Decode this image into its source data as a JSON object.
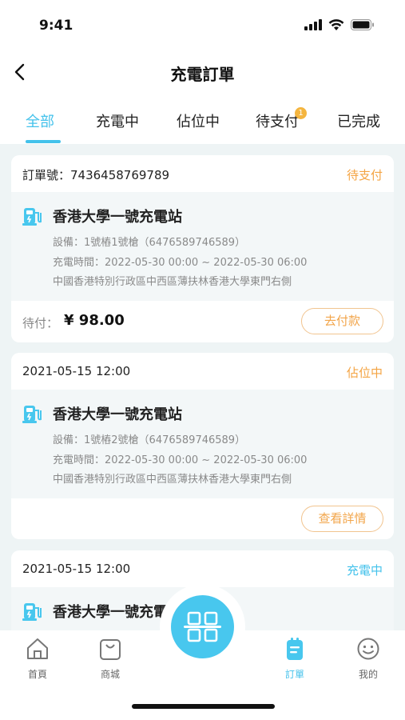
{
  "status_bar": {
    "time": "9:41"
  },
  "header": {
    "title": "充電訂單"
  },
  "tabs": [
    {
      "label": "全部"
    },
    {
      "label": "充電中"
    },
    {
      "label": "佔位中"
    },
    {
      "label": "待支付",
      "badge": "1"
    },
    {
      "label": "已完成"
    }
  ],
  "orders": [
    {
      "head_left": "訂單號：7436458769789",
      "status": "待支付",
      "station": "香港大學一號充電站",
      "device": "設備：1號樁1號槍（6476589746589）",
      "time": "充電時間：2022-05-30 00:00 ~ 2022-05-30 06:00",
      "address": "中國香港特別行政區中西區薄扶林香港大學東門右側",
      "pay_label": "待付：",
      "amount": "¥ 98.00",
      "action": "去付款"
    },
    {
      "head_left": "2021-05-15 12:00",
      "status": "佔位中",
      "station": "香港大學一號充電站",
      "device": "設備：1號樁2號槍（6476589746589）",
      "time": "充電時間：2022-05-30 00:00 ~ 2022-05-30 06:00",
      "address": "中國香港特別行政區中西區薄扶林香港大學東門右側",
      "action": "查看詳情"
    },
    {
      "head_left": "2021-05-15 12:00",
      "status": "充電中",
      "station": "香港大學一號充電站"
    }
  ],
  "tabbar": [
    {
      "label": "首頁",
      "icon": "home-icon"
    },
    {
      "label": "商城",
      "icon": "shopping-bag-icon"
    },
    {
      "label": "",
      "icon": "scan-icon"
    },
    {
      "label": "訂單",
      "icon": "order-icon"
    },
    {
      "label": "我的",
      "icon": "profile-icon"
    }
  ],
  "colors": {
    "accent": "#44c2eb",
    "warning": "#f4a443",
    "background": "#eef4f5"
  }
}
